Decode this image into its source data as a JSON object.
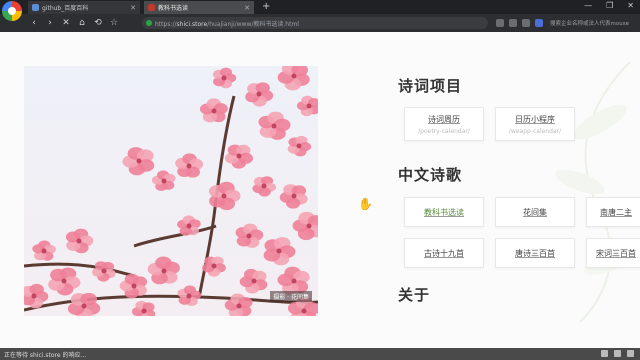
{
  "browser": {
    "tabs": [
      {
        "label": "github_百度百科",
        "active": false
      },
      {
        "label": "教科书选读",
        "active": true
      }
    ],
    "new_tab": "+",
    "window_controls": [
      "—",
      "❐",
      "✕"
    ],
    "nav": {
      "back": "‹",
      "forward": "›",
      "reload": "✕",
      "undo": "⟲",
      "home": "⌂",
      "star": "☆"
    },
    "url_host": "shici.store",
    "url_path": "/huajianji/www/教科书选读.html",
    "url_prefix": "https://",
    "extension_label": "搜索企业名称或法人代表mouse"
  },
  "photo": {
    "caption": "摄影 · 花间集",
    "description_icon": "cherry-blossom-photo"
  },
  "sections": {
    "poetry_project": {
      "title": "诗词项目",
      "cards": [
        {
          "title": "诗词周历",
          "subtitle": "/poetry-calendar/"
        },
        {
          "title": "日历小程序",
          "subtitle": "/weapp-calendar/"
        }
      ]
    },
    "chinese_poetry": {
      "title": "中文诗歌",
      "cards": [
        {
          "title": "教科书选读",
          "accent": true
        },
        {
          "title": "花间集"
        },
        {
          "title": "南唐二主"
        },
        {
          "title": "古诗十九首"
        },
        {
          "title": "唐诗三百首"
        },
        {
          "title": "宋词三百首"
        }
      ]
    },
    "about": {
      "title": "关于"
    }
  },
  "statusbar": {
    "text": "正在等待 shici.store 的响应..."
  },
  "colors": {
    "accent_green": "#5a8a3a",
    "blossom_pink": "#f08aa0",
    "chrome_dark": "#202124"
  }
}
